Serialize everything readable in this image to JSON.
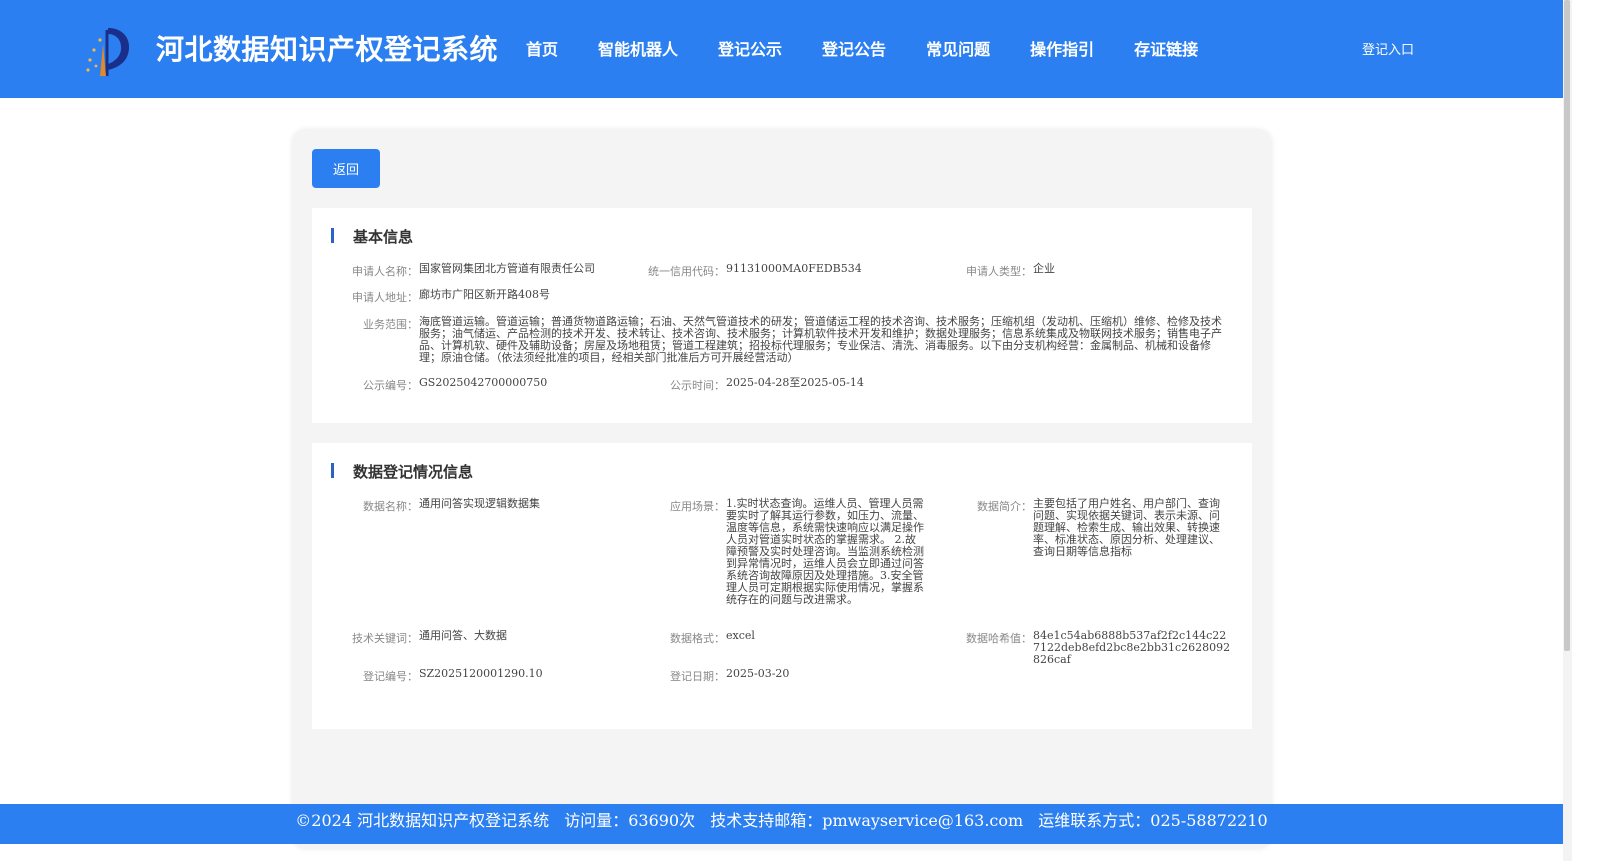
{
  "header": {
    "title": "河北数据知识产权登记系统",
    "nav": [
      "首页",
      "智能机器人",
      "登记公示",
      "登记公告",
      "常见问题",
      "操作指引",
      "存证链接"
    ],
    "login": "登记入口",
    "logo_icon": "pen-nib-star-logo",
    "accent_color": "#2b7ff0"
  },
  "back_label": "返回",
  "basic": {
    "title": "基本信息",
    "applicant_name_label": "申请人名称：",
    "applicant_name": "国家管网集团北方管道有限责任公司",
    "credit_code_label": "统一信用代码：",
    "credit_code": "91131000MA0FEDB534",
    "applicant_type_label": "申请人类型：",
    "applicant_type": "企业",
    "address_label": "申请人地址：",
    "address": "廊坊市广阳区新开路408号",
    "scope_label": "业务范围：",
    "scope": "海底管道运输。管道运输；普通货物道路运输；石油、天然气管道技术的研发；管道储运工程的技术咨询、技术服务；压缩机组（发动机、压缩机）维修、检修及技术服务；油气储运、产品检测的技术开发、技术转让、技术咨询、技术服务；计算机软件技术开发和维护；数据处理服务；信息系统集成及物联网技术服务；销售电子产品、计算机软、硬件及辅助设备；房屋及场地租赁；管道工程建筑；招投标代理服务；专业保洁、清洗、消毒服务。以下由分支机构经营：金属制品、机械和设备修理；原油仓储。（依法须经批准的项目，经相关部门批准后方可开展经营活动）",
    "pub_no_label": "公示编号：",
    "pub_no": "GS2025042700000750",
    "pub_time_label": "公示时间：",
    "pub_time": "2025-04-28至2025-05-14"
  },
  "registration": {
    "title": "数据登记情况信息",
    "data_name_label": "数据名称：",
    "data_name": "通用问答实现逻辑数据集",
    "scenario_label": "应用场景：",
    "scenario": "1.实时状态查询。运维人员、管理人员需要实时了解其运行参数，如压力、流量、温度等信息，系统需快速响应以满足操作人员对管道实时状态的掌握需求。 2.故障预警及实时处理咨询。当监测系统检测到异常情况时，运维人员会立即通过问答系统咨询故障原因及处理措施。3.安全管理人员可定期根据实际使用情况，掌握系统存在的问题与改进需求。",
    "intro_label": "数据简介：",
    "intro": "主要包括了用户姓名、用户部门、查询问题、实现依据关键词、表示未源、问题理解、检索生成、输出效果、转换速率、标准状态、原因分析、处理建议、查询日期等信息指标",
    "keywords_label": "技术关键词：",
    "keywords": "通用问答、大数据",
    "format_label": "数据格式：",
    "format": "excel",
    "hash_label": "数据哈希值：",
    "hash": "84e1c54ab6888b537af2f2c144c227122deb8efd2bc8e2bb31c2628092826caf",
    "reg_no_label": "登记编号：",
    "reg_no": "SZ2025120001290.10",
    "reg_date_label": "登记日期：",
    "reg_date": "2025-03-20"
  },
  "footer": {
    "copyright": "©2024 河北数据知识产权登记系统",
    "visits": "访问量：63690次",
    "email": "技术支持邮箱：pmwayservice@163.com",
    "phone": "运维联系方式：025-58872210"
  }
}
